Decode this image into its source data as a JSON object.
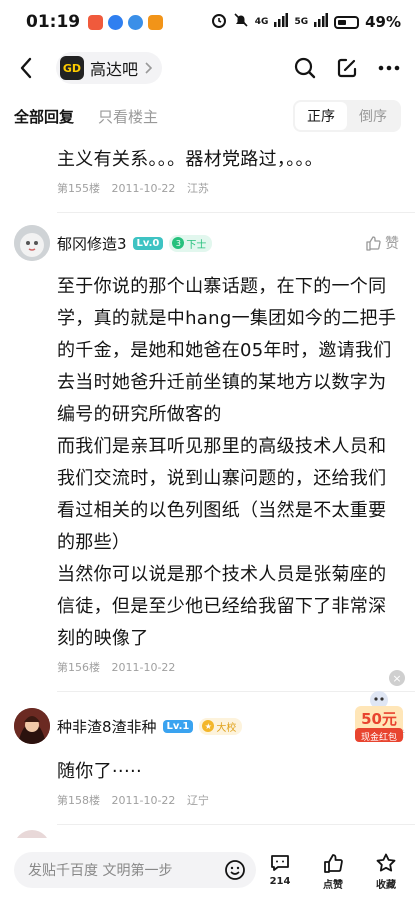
{
  "status_bar": {
    "time": "01:19",
    "network": "4G",
    "network2": "5G",
    "battery": "49%"
  },
  "header": {
    "forum_name": "高达吧",
    "forum_logo_text": "GD"
  },
  "tabs": {
    "all": "全部回复",
    "owner_only": "只看楼主",
    "order_asc": "正序",
    "order_desc": "倒序"
  },
  "floor155": {
    "text": "主义有关系。。。器材党路过，。。。",
    "floor": "第155楼",
    "date": "2011-10-22",
    "location": "江苏"
  },
  "floor156": {
    "username": "郁冈修造3",
    "level": "Lv.0",
    "title": "下士",
    "title_num": "3",
    "like_label": "赞",
    "paragraphs": [
      "至于你说的那个山寨话题，在下的一个同学，真的就是中hang一集团如今的二把手的千金，是她和她爸在05年时，邀请我们去当时她爸升迁前坐镇的某地方以数字为编号的研究所做客的",
      "而我们是亲耳听见那里的高级技术人员和我们交流时，说到山寨问题的，还给我们看过相关的以色列图纸（当然是不太重要的那些）",
      "当然你可以说是那个技术人员是张菊座的信徒，但是至少他已经给我留下了非常深刻的映像了"
    ],
    "floor": "第156楼",
    "date": "2011-10-22"
  },
  "ad": {
    "label": "广告",
    "amount": "50元",
    "caption": "现金红包"
  },
  "floor158": {
    "username": "种非渣8渣非种",
    "level": "Lv.1",
    "title": "大校",
    "text": "随你了·····",
    "floor": "第158楼",
    "date": "2011-10-22",
    "location": "辽宁"
  },
  "bottom_bar": {
    "compose_placeholder": "发贴千百度 文明第一步",
    "comments_count": "214",
    "like_label": "点赞",
    "collect_label": "收藏"
  },
  "colors": {
    "lv0": "#3ec3c3",
    "lv1": "#3aa3f0",
    "rank_green": "#26c17d",
    "rank_gold": "#f3b62a",
    "redpack": "#e8442f"
  }
}
